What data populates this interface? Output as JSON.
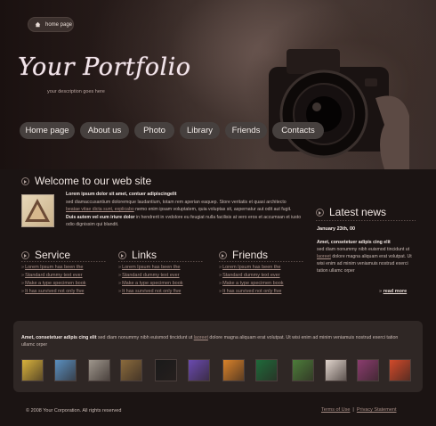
{
  "header": {
    "home_label": "home page",
    "logo_text": "Your Portfolio",
    "tagline": "your description goes here"
  },
  "nav": {
    "items": [
      {
        "label": "Home page"
      },
      {
        "label": "About us"
      },
      {
        "label": "Photo"
      },
      {
        "label": "Library"
      },
      {
        "label": "Friends"
      },
      {
        "label": "Contacts"
      }
    ]
  },
  "welcome": {
    "title": "Welcome to our web site",
    "lead": "Lorem ipsum dolor sit amet, contuer adipiscingelit",
    "line1": "sed diamaccusantium doloremque laudantium, totam rem aperian eaquep. Store veritatis et quasi architecto",
    "link1": "beatae vitae dicta sunt, explicabo",
    "line2": " nemo enim ipsam voluptatem, quia voluptas sit, aspernatur aut odit aut fugit.",
    "bold2": " Duis autem vel eum iriure dolor",
    "line3": " in hendrerit in vvdolore eu feugiat nulla facilisis at vero eros et accumsan et iusto odio dignissim qui blandit."
  },
  "service": {
    "title": "Service",
    "items": [
      "Lorem Ipsum has been the",
      "Standard dummy text ever",
      "Make a type specimen book",
      "It has survived not only five"
    ]
  },
  "links": {
    "title": "Links",
    "items": [
      "Lorem Ipsum has been the",
      "Standard dummy text ever",
      "Make a type specimen book",
      "It has survived not only five"
    ]
  },
  "friends": {
    "title": "Friends",
    "items": [
      "Lorem Ipsum has been the",
      "Standard dummy text ever",
      "Make a type specimen book",
      "It has survived not only five"
    ]
  },
  "news": {
    "title": "Latest news",
    "date": "January 23th, 00",
    "lead": "Amet, consetetuer adipis cing elit",
    "text1": "sed diam nonummy nibh euismod tincidunt ut",
    "link": "laoreet",
    "text2": " dolore magna aliquam erat volutpat.  Ut wisi enim ad minim veniamuis nostrud exerci tation ullamc orper",
    "read_more": "read more"
  },
  "gallery": {
    "lead": "Amet, consetetuer adipis cing elit",
    "text1": " sed diam nonummy nibh euismod tincidunt ut ",
    "link": "laoreet",
    "text2": " dolore magna aliquam erat volutpat.   Ut wisi enim ad minim veniamuis nostrud exerci tation ullamc orper",
    "thumb_colors": [
      "#d8b23c",
      "#5a8fbf",
      "#9e968c",
      "#8a6a3c",
      "#1a1a1a",
      "#6a4ab0",
      "#d9822a",
      "#1f6a3a",
      "#4c7c3a",
      "#e0d4cc",
      "#8a3c6e",
      "#d24a2a"
    ]
  },
  "footer": {
    "copyright": "© 2008 Your Corporation. All rights reserved",
    "terms": "Terms of Use",
    "separator": "|",
    "privacy": "Privacy Statement"
  }
}
